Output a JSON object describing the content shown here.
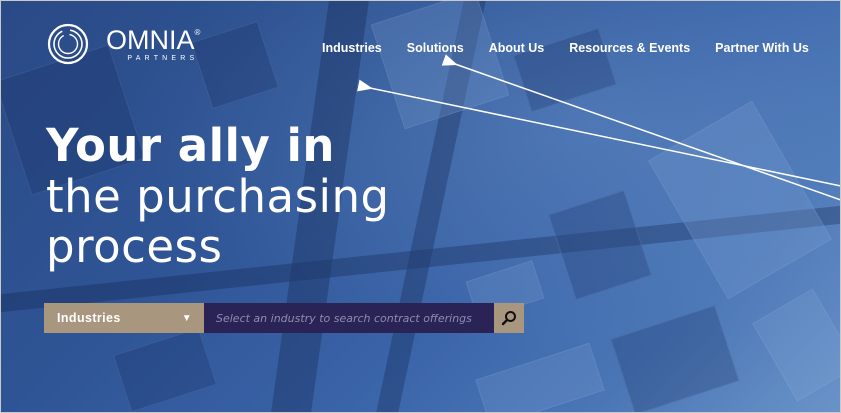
{
  "brand": {
    "name": "OMNIA",
    "registered": "®",
    "sub": "PARTNERS"
  },
  "nav": {
    "items": [
      {
        "label": "Industries"
      },
      {
        "label": "Solutions"
      },
      {
        "label": "About Us"
      },
      {
        "label": "Resources & Events"
      },
      {
        "label": "Partner With Us"
      }
    ]
  },
  "hero": {
    "line1": "Your ally in",
    "line2": "the purchasing",
    "line3": "process"
  },
  "search": {
    "dropdown_label": "Industries",
    "placeholder": "Select an industry to search contract offerings",
    "icon": "search-icon"
  },
  "colors": {
    "hero_bg": "#2f5596",
    "dropdown_bg": "#a8967f",
    "input_bg": "#2a2456",
    "text": "#ffffff"
  }
}
